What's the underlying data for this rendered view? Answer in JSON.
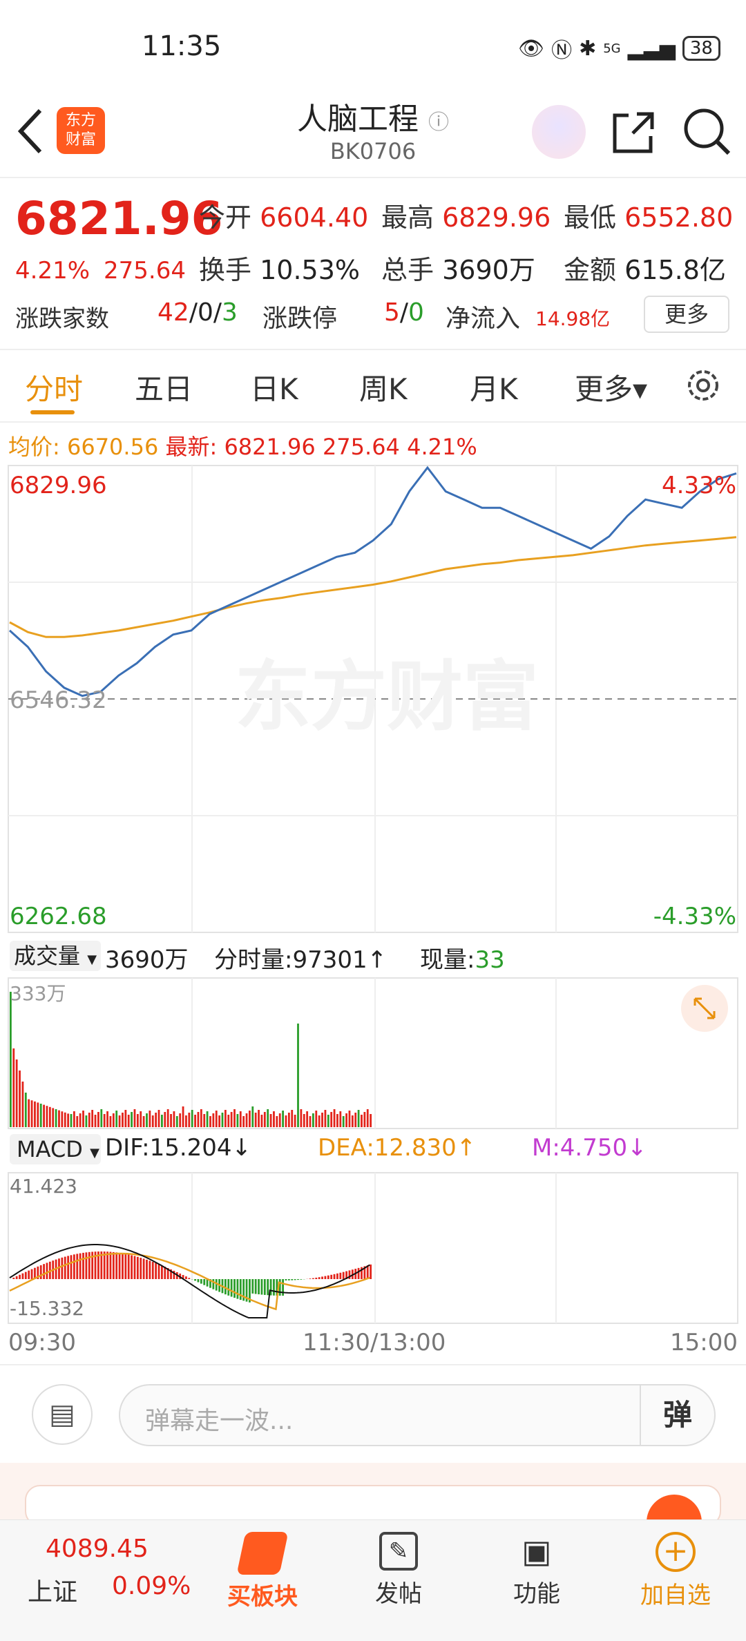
{
  "status_bar": {
    "time": "11:35",
    "battery": "38",
    "network": "5G"
  },
  "header": {
    "title": "人脑工程",
    "code": "BK0706",
    "logo_text_1": "东方",
    "logo_text_2": "财富"
  },
  "quote": {
    "price": "6821.96",
    "change_pct": "4.21%",
    "change": "275.64",
    "open_label": "今开",
    "open": "6604.40",
    "high_label": "最高",
    "high": "6829.96",
    "low_label": "最低",
    "low": "6552.80",
    "turnover_label": "换手",
    "turnover": "10.53%",
    "volume_label": "总手",
    "volume": "3690万",
    "amount_label": "金额",
    "amount": "615.8亿",
    "breadth_label": "涨跌家数",
    "breadth_up": "42",
    "breadth_flat": "0",
    "breadth_down": "3",
    "limit_label": "涨跌停",
    "limit_up": "5",
    "limit_down": "0",
    "netflow_label": "净流入",
    "netflow": "14.98亿",
    "more_label": "更多"
  },
  "tabs": {
    "t1": "分时",
    "t2": "五日",
    "t3": "日K",
    "t4": "周K",
    "t5": "月K",
    "t6": "更多▾"
  },
  "avg_line": {
    "avg_label": "均价:",
    "avg": "6670.56",
    "latest_label": "最新:",
    "latest": "6821.96",
    "chg": "275.64",
    "pct": "4.21%"
  },
  "chart_data": [
    {
      "type": "line",
      "title": "分时",
      "ylim": [
        6262.68,
        6829.96
      ],
      "y_top_label": "6829.96",
      "y_mid_label": "6546.32",
      "y_bottom_label": "6262.68",
      "pct_top_label": "4.33%",
      "pct_bottom_label": "-4.33%",
      "x_labels": [
        "09:30",
        "11:30/13:00",
        "15:00"
      ],
      "series": [
        {
          "values": [
            6630,
            6610,
            6580,
            6560,
            6550,
            6555,
            6575,
            6590,
            6610,
            6625,
            6630,
            6650,
            6660,
            6670,
            6680,
            6690,
            6700,
            6710,
            6720,
            6725,
            6740,
            6760,
            6800,
            6829,
            6800,
            6790,
            6780,
            6780,
            6770,
            6760,
            6750,
            6740,
            6730,
            6745,
            6770,
            6790,
            6785,
            6780,
            6800,
            6815,
            6822
          ]
        },
        {
          "values": [
            6640,
            6628,
            6622,
            6622,
            6624,
            6627,
            6630,
            6634,
            6638,
            6642,
            6647,
            6652,
            6658,
            6663,
            6667,
            6670,
            6674,
            6677,
            6680,
            6683,
            6686,
            6690,
            6695,
            6700,
            6705,
            6708,
            6711,
            6713,
            6716,
            6718,
            6720,
            6722,
            6725,
            6728,
            6731,
            6734,
            6736,
            6738,
            6740,
            6742,
            6744
          ]
        }
      ]
    },
    {
      "type": "bar",
      "title": "成交量",
      "ylabel_top": "333万",
      "total_label": "3690万",
      "minute_vol_label": "分时量:97301↑",
      "current_label": "现量:",
      "current": "33"
    },
    {
      "type": "line",
      "title": "MACD",
      "dif_label": "DIF:15.204↓",
      "dea_label": "DEA:12.830↑",
      "m_label": "M:4.750↓",
      "ylim": [
        -15.332,
        41.423
      ],
      "y_top_label": "41.423",
      "y_bottom_label": "-15.332"
    }
  ],
  "danmu": {
    "placeholder": "弹幕走一波...",
    "btn": "弹"
  },
  "nav": {
    "index_value": "4089.45",
    "index_name": "上证",
    "index_pct": "0.09%",
    "buy_board": "买板块",
    "post": "发帖",
    "functions": "功能",
    "add_fav": "加自选"
  },
  "colors": {
    "up": "#e2231a",
    "down": "#2a9d2a",
    "accent": "#e8900c",
    "price_line": "#3a6fb5",
    "avg_line": "#e8a020"
  }
}
